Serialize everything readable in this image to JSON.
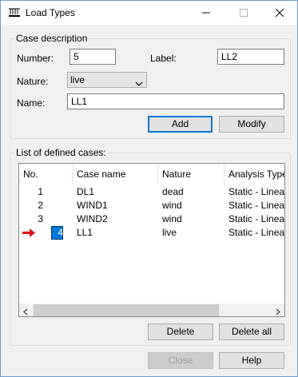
{
  "window": {
    "title": "Load Types"
  },
  "case_description": {
    "legend": "Case description",
    "number_label": "Number:",
    "number_value": "5",
    "label_label": "Label:",
    "label_value": "LL2",
    "nature_label": "Nature:",
    "nature_value": "live",
    "name_label": "Name:",
    "name_value": "LL1",
    "add_button": "Add",
    "modify_button": "Modify"
  },
  "cases_list": {
    "legend": "List of defined cases:",
    "columns": [
      "No.",
      "Case name",
      "Nature",
      "Analysis Type"
    ],
    "rows": [
      {
        "no": "1",
        "name": "DL1",
        "nature": "dead",
        "analysis": "Static - Linear"
      },
      {
        "no": "2",
        "name": "WIND1",
        "nature": "wind",
        "analysis": "Static - Linear"
      },
      {
        "no": "3",
        "name": "WIND2",
        "nature": "wind",
        "analysis": "Static - Linear"
      },
      {
        "no": "4",
        "name": "LL1",
        "nature": "live",
        "analysis": "Static - Linear"
      }
    ],
    "selected_row": 3,
    "delete_button": "Delete",
    "delete_all_button": "Delete all"
  },
  "footer": {
    "close_button": "Close",
    "help_button": "Help"
  },
  "icons": {
    "app": "load-types-icon",
    "pointer": "red-arrow-icon"
  },
  "colors": {
    "selection": "#0078d7",
    "default_button_border": "#0078d7",
    "arrow": "#e01010"
  }
}
